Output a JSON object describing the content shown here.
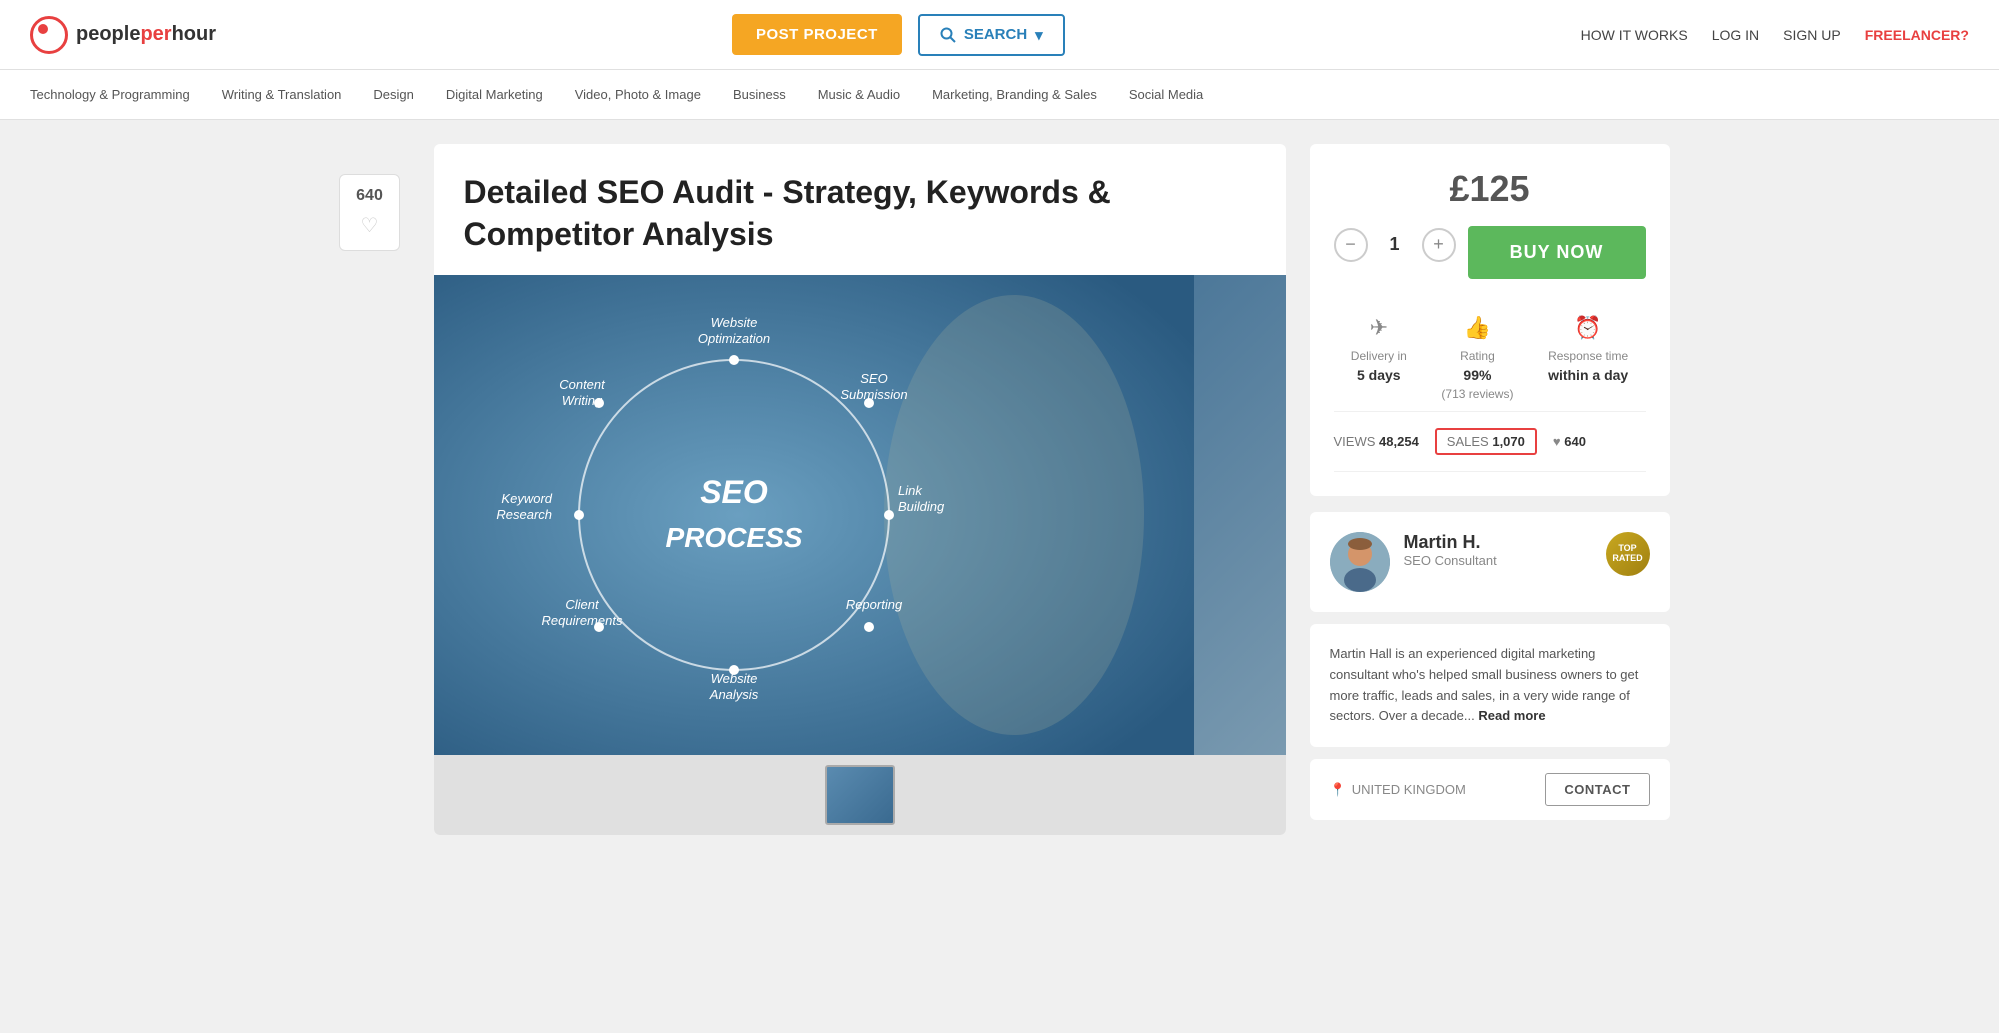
{
  "header": {
    "logo_people": "people",
    "logo_per": "per",
    "logo_hour": "hour",
    "btn_post_project": "POST PROJECT",
    "btn_search": "SEARCH",
    "btn_search_chevron": "▾",
    "nav_how_it_works": "HOW IT WORKS",
    "nav_login": "LOG IN",
    "nav_signup": "SIGN UP",
    "nav_freelancer": "FREELANCER?"
  },
  "categories": [
    {
      "label": "Technology & Programming"
    },
    {
      "label": "Writing & Translation"
    },
    {
      "label": "Design"
    },
    {
      "label": "Digital Marketing"
    },
    {
      "label": "Video, Photo & Image"
    },
    {
      "label": "Business"
    },
    {
      "label": "Music & Audio"
    },
    {
      "label": "Marketing, Branding & Sales"
    },
    {
      "label": "Social Media"
    }
  ],
  "sidebar_left": {
    "like_count": "640",
    "heart": "♡"
  },
  "listing": {
    "title": "Detailed SEO Audit - Strategy, Keywords & Competitor Analysis",
    "diagram_center_line1": "SEO",
    "diagram_center_line2": "PROCESS",
    "diagram_labels": [
      "Website\nOptimization",
      "SEO\nSubmission",
      "Link\nBuilding",
      "Reporting",
      "Website\nAnalysis",
      "Client\nRequirements",
      "Keyword\nResearch",
      "Content\nWriting"
    ]
  },
  "pricing": {
    "price": "£125",
    "quantity": "1",
    "btn_buy_now": "BUY NOW",
    "qty_minus": "−",
    "qty_plus": "+"
  },
  "stats": {
    "delivery_label": "Delivery in",
    "delivery_value": "5 days",
    "rating_label": "Rating",
    "rating_value": "99%",
    "rating_reviews": "(713 reviews)",
    "response_label": "Response time",
    "response_value": "within a day"
  },
  "metrics": {
    "views_label": "VIEWS",
    "views_value": "48,254",
    "sales_label": "SALES",
    "sales_value": "1,070",
    "heart": "♥",
    "likes": "640"
  },
  "seller": {
    "name": "Martin H.",
    "title": "SEO Consultant",
    "badge_top_line1": "TOP",
    "badge_top_line2": "RATED",
    "bio": "Martin Hall is an experienced digital marketing consultant who's helped small business owners to get more traffic, leads and sales, in a very wide range of sectors. Over a decade...",
    "read_more": "Read more",
    "location": "UNITED KINGDOM",
    "btn_contact": "CONTACT"
  }
}
